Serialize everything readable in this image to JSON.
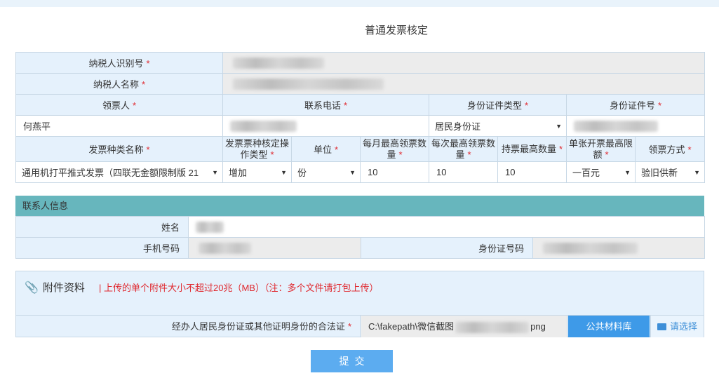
{
  "page": {
    "title": "普通发票核定"
  },
  "taxpayer": {
    "id_label": "纳税人识别号",
    "name_label": "纳税人名称"
  },
  "receiver": {
    "person_label": "领票人",
    "phone_label": "联系电话",
    "id_type_label": "身份证件类型",
    "id_no_label": "身份证件号",
    "person_value": "何燕平",
    "id_type_value": "居民身份证"
  },
  "invoice": {
    "headers": {
      "type_name": "发票种类名称",
      "op_type": "发票票种核定操作类型",
      "unit": "单位",
      "monthly_max": "每月最高领票数量",
      "each_max": "每次最高领票数量",
      "hold_max": "持票最高数量",
      "single_limit": "单张开票最高限额",
      "method": "领票方式"
    },
    "row": {
      "type_name": "通用机打平推式发票（四联无金额限制版 21",
      "op_type": "增加",
      "unit": "份",
      "monthly_max": "10",
      "each_max": "10",
      "hold_max": "10",
      "single_limit": "一百元",
      "method": "验旧供新"
    }
  },
  "contact": {
    "section_title": "联系人信息",
    "name_label": "姓名",
    "mobile_label": "手机号码",
    "id_label": "身份证号码"
  },
  "attachment": {
    "title": "附件资料",
    "note": "| 上传的单个附件大小不超过20兆（MB）（注：多个文件请打包上传）",
    "doc_label": "经办人居民身份证或其他证明身份的合法证",
    "path_prefix": "C:\\fakepath\\微信截图",
    "path_suffix": "png",
    "public_btn": "公共材料库",
    "choose_btn": "请选择"
  },
  "actions": {
    "submit": "提交"
  },
  "required_mark": "*"
}
